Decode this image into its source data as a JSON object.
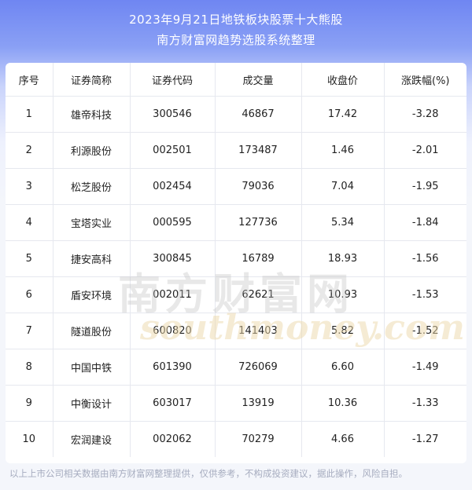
{
  "header": {
    "title": "2023年9月21日地铁板块股票十大熊股",
    "subtitle": "南方财富网趋势选股系统整理"
  },
  "table": {
    "columns": [
      "序号",
      "证券简称",
      "证券代码",
      "成交量",
      "收盘价",
      "涨跌幅(%)"
    ],
    "rows": [
      [
        "1",
        "雄帝科技",
        "300546",
        "46867",
        "17.42",
        "-3.28"
      ],
      [
        "2",
        "利源股份",
        "002501",
        "173487",
        "1.46",
        "-2.01"
      ],
      [
        "3",
        "松芝股份",
        "002454",
        "79036",
        "7.04",
        "-1.95"
      ],
      [
        "4",
        "宝塔实业",
        "000595",
        "127736",
        "5.34",
        "-1.84"
      ],
      [
        "5",
        "捷安高科",
        "300845",
        "16789",
        "18.93",
        "-1.56"
      ],
      [
        "6",
        "盾安环境",
        "002011",
        "62621",
        "10.93",
        "-1.53"
      ],
      [
        "7",
        "隧道股份",
        "600820",
        "141403",
        "5.82",
        "-1.52"
      ],
      [
        "8",
        "中国中铁",
        "601390",
        "726069",
        "6.60",
        "-1.49"
      ],
      [
        "9",
        "中衡设计",
        "603017",
        "13919",
        "10.36",
        "-1.33"
      ],
      [
        "10",
        "宏润建设",
        "002062",
        "70279",
        "4.66",
        "-1.27"
      ]
    ]
  },
  "watermark": {
    "cn": "南方财富网",
    "en": "southmoney.com"
  },
  "footer": {
    "disclaimer": "以上上市公司相关数据由南方财富网整理提供，仅供参考，不构成投资建议，据此操作，风险自担。"
  }
}
